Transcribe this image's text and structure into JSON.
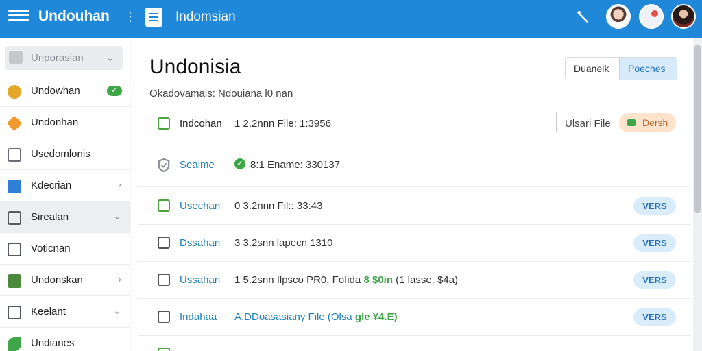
{
  "header": {
    "app_title": "Undouhan",
    "document_title": "Indomsian",
    "menu_glyph": "⋮"
  },
  "icons": {
    "hamburger": "menu-icon",
    "doc": "document-icon",
    "pen": "pen-icon"
  },
  "sidebar": {
    "search_label": "Unporasian",
    "items": [
      {
        "label": "Undowhan",
        "badge": "✓",
        "icon": "coin-icon",
        "color": "#e5a72a"
      },
      {
        "label": "Undonhan",
        "icon": "tag-icon",
        "color": "#f09a2e"
      },
      {
        "label": "Usedomlonis",
        "icon": "list-icon",
        "color": "#6b6f75"
      },
      {
        "label": "Kdecrian",
        "icon": "cube-icon",
        "color": "#2f7fd6"
      },
      {
        "label": "Sirealan",
        "icon": "table-icon",
        "color": "#555a60"
      },
      {
        "label": "Voticnan",
        "icon": "grid-icon",
        "color": "#555a60"
      },
      {
        "label": "Undonskan",
        "icon": "chart-icon",
        "color": "#4a8a3a"
      },
      {
        "label": "Keelant",
        "icon": "check-square-icon",
        "color": "#555a60"
      },
      {
        "label": "Undianes",
        "icon": "leaf-icon",
        "color": "#3fa648"
      }
    ]
  },
  "main": {
    "title": "Undonisia",
    "subtitle": "Okadovamais: Ndouiana l0 nan",
    "segments": [
      "Duaneik",
      "Poeches"
    ],
    "rows": [
      {
        "name": "Indcohan",
        "detail": "1 2.2nnn File: 1:3956",
        "action_label": "Ulsari File",
        "action_button": "Dersh"
      },
      {
        "name": "Seaime",
        "detail_status": "✓",
        "detail": "8:1 Ename: 330137"
      },
      {
        "name": "Usechan",
        "detail": "0 3.2nnn Fil:: 33:43",
        "pill": "VERS"
      },
      {
        "name": "Dssahan",
        "detail": "3 3.2snn lapecn 1310",
        "pill": "VERS"
      },
      {
        "name": "Ussahan",
        "detail": "1 5.2snn Ilpsco PR0, Fofida",
        "detail_green": "8 $0in",
        "detail_tail": "(1 lasse: $4a)",
        "pill": "VERS"
      },
      {
        "name": "Indahaa",
        "detail": "A.DDoasasiany File (Olsa",
        "detail_green": "gle ¥4.E)",
        "pill": "VERS"
      }
    ]
  },
  "colors": {
    "topbar": "#1f88d8",
    "pill_bg": "#d9ecfb",
    "pill_text": "#2570b8",
    "link_teal": "#1f7fb8",
    "green": "#3fa648"
  }
}
